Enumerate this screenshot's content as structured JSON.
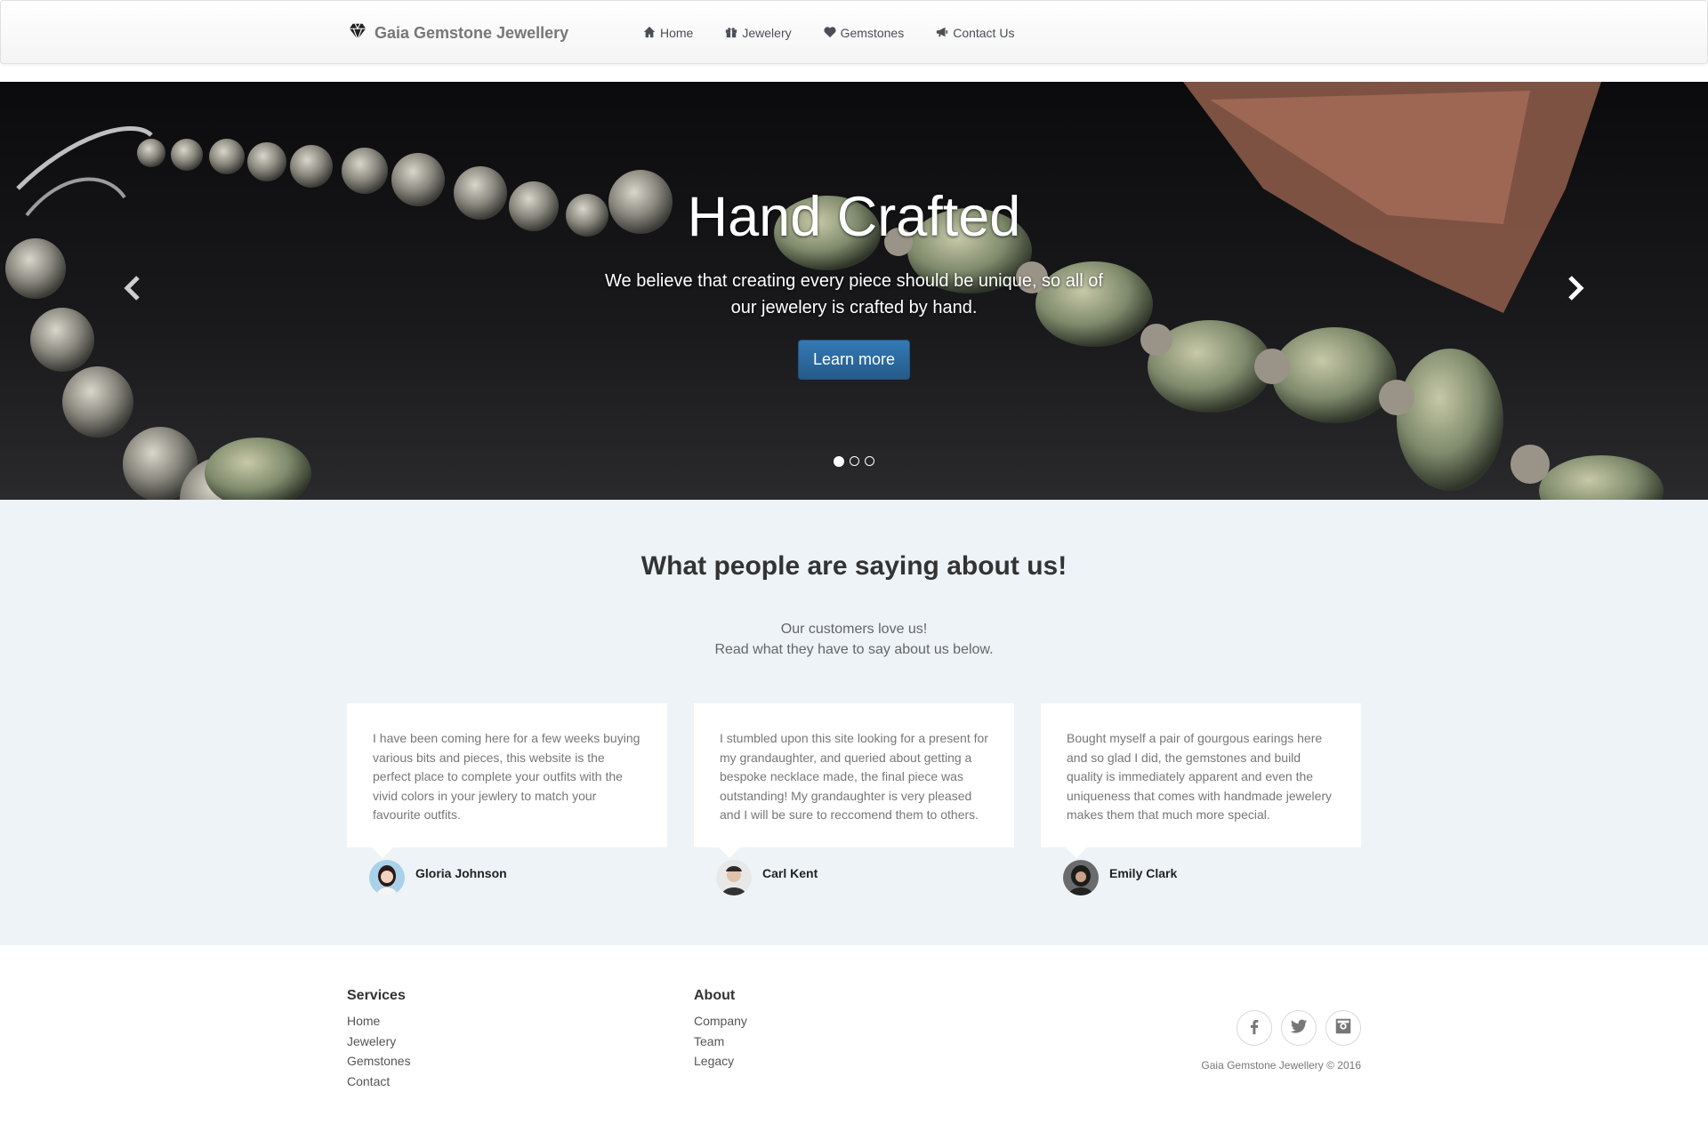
{
  "brand": {
    "name": "Gaia Gemstone Jewellery",
    "icon": "diamond-icon"
  },
  "nav": {
    "items": [
      {
        "label": "Home",
        "icon": "home-icon"
      },
      {
        "label": "Jewelery",
        "icon": "gift-icon"
      },
      {
        "label": "Gemstones",
        "icon": "heart-icon"
      },
      {
        "label": "Contact Us",
        "icon": "bullhorn-icon"
      }
    ]
  },
  "hero": {
    "title": "Hand Crafted",
    "text": "We believe that creating every piece should be unique, so all of our jewelery is crafted by hand.",
    "button": "Learn more",
    "slides": 3,
    "active_slide": 1
  },
  "testimonials": {
    "title": "What people are saying about us!",
    "subtitle_line1": "Our customers love us!",
    "subtitle_line2": "Read what they have to say about us below.",
    "items": [
      {
        "text": "I have been coming here for a few weeks buying various bits and pieces, this website is the perfect place to complete your outfits with the vivid colors in your jewlery to match your favourite outfits.",
        "name": "Gloria Johnson"
      },
      {
        "text": "I stumbled upon this site looking for a present for my grandaughter, and queried about getting a bespoke necklace made, the final piece was outstanding! My grandaughter is very pleased and I will be sure to reccomend them to others.",
        "name": "Carl Kent"
      },
      {
        "text": "Bought myself a pair of gourgous earings here and so glad I did, the gemstones and build quality is immediately apparent and even the uniqueness that comes with handmade jewelery makes them that much more special.",
        "name": "Emily Clark"
      }
    ]
  },
  "footer": {
    "services": {
      "title": "Services",
      "links": [
        "Home",
        "Jewelery",
        "Gemstones",
        "Contact"
      ]
    },
    "about": {
      "title": "About",
      "links": [
        "Company",
        "Team",
        "Legacy"
      ]
    },
    "socials": [
      "facebook-icon",
      "twitter-icon",
      "instagram-icon"
    ],
    "copyright": "Gaia Gemstone Jewellery © 2016"
  },
  "colors": {
    "accent": "#337ab7",
    "section_bg": "#eef3f7"
  }
}
